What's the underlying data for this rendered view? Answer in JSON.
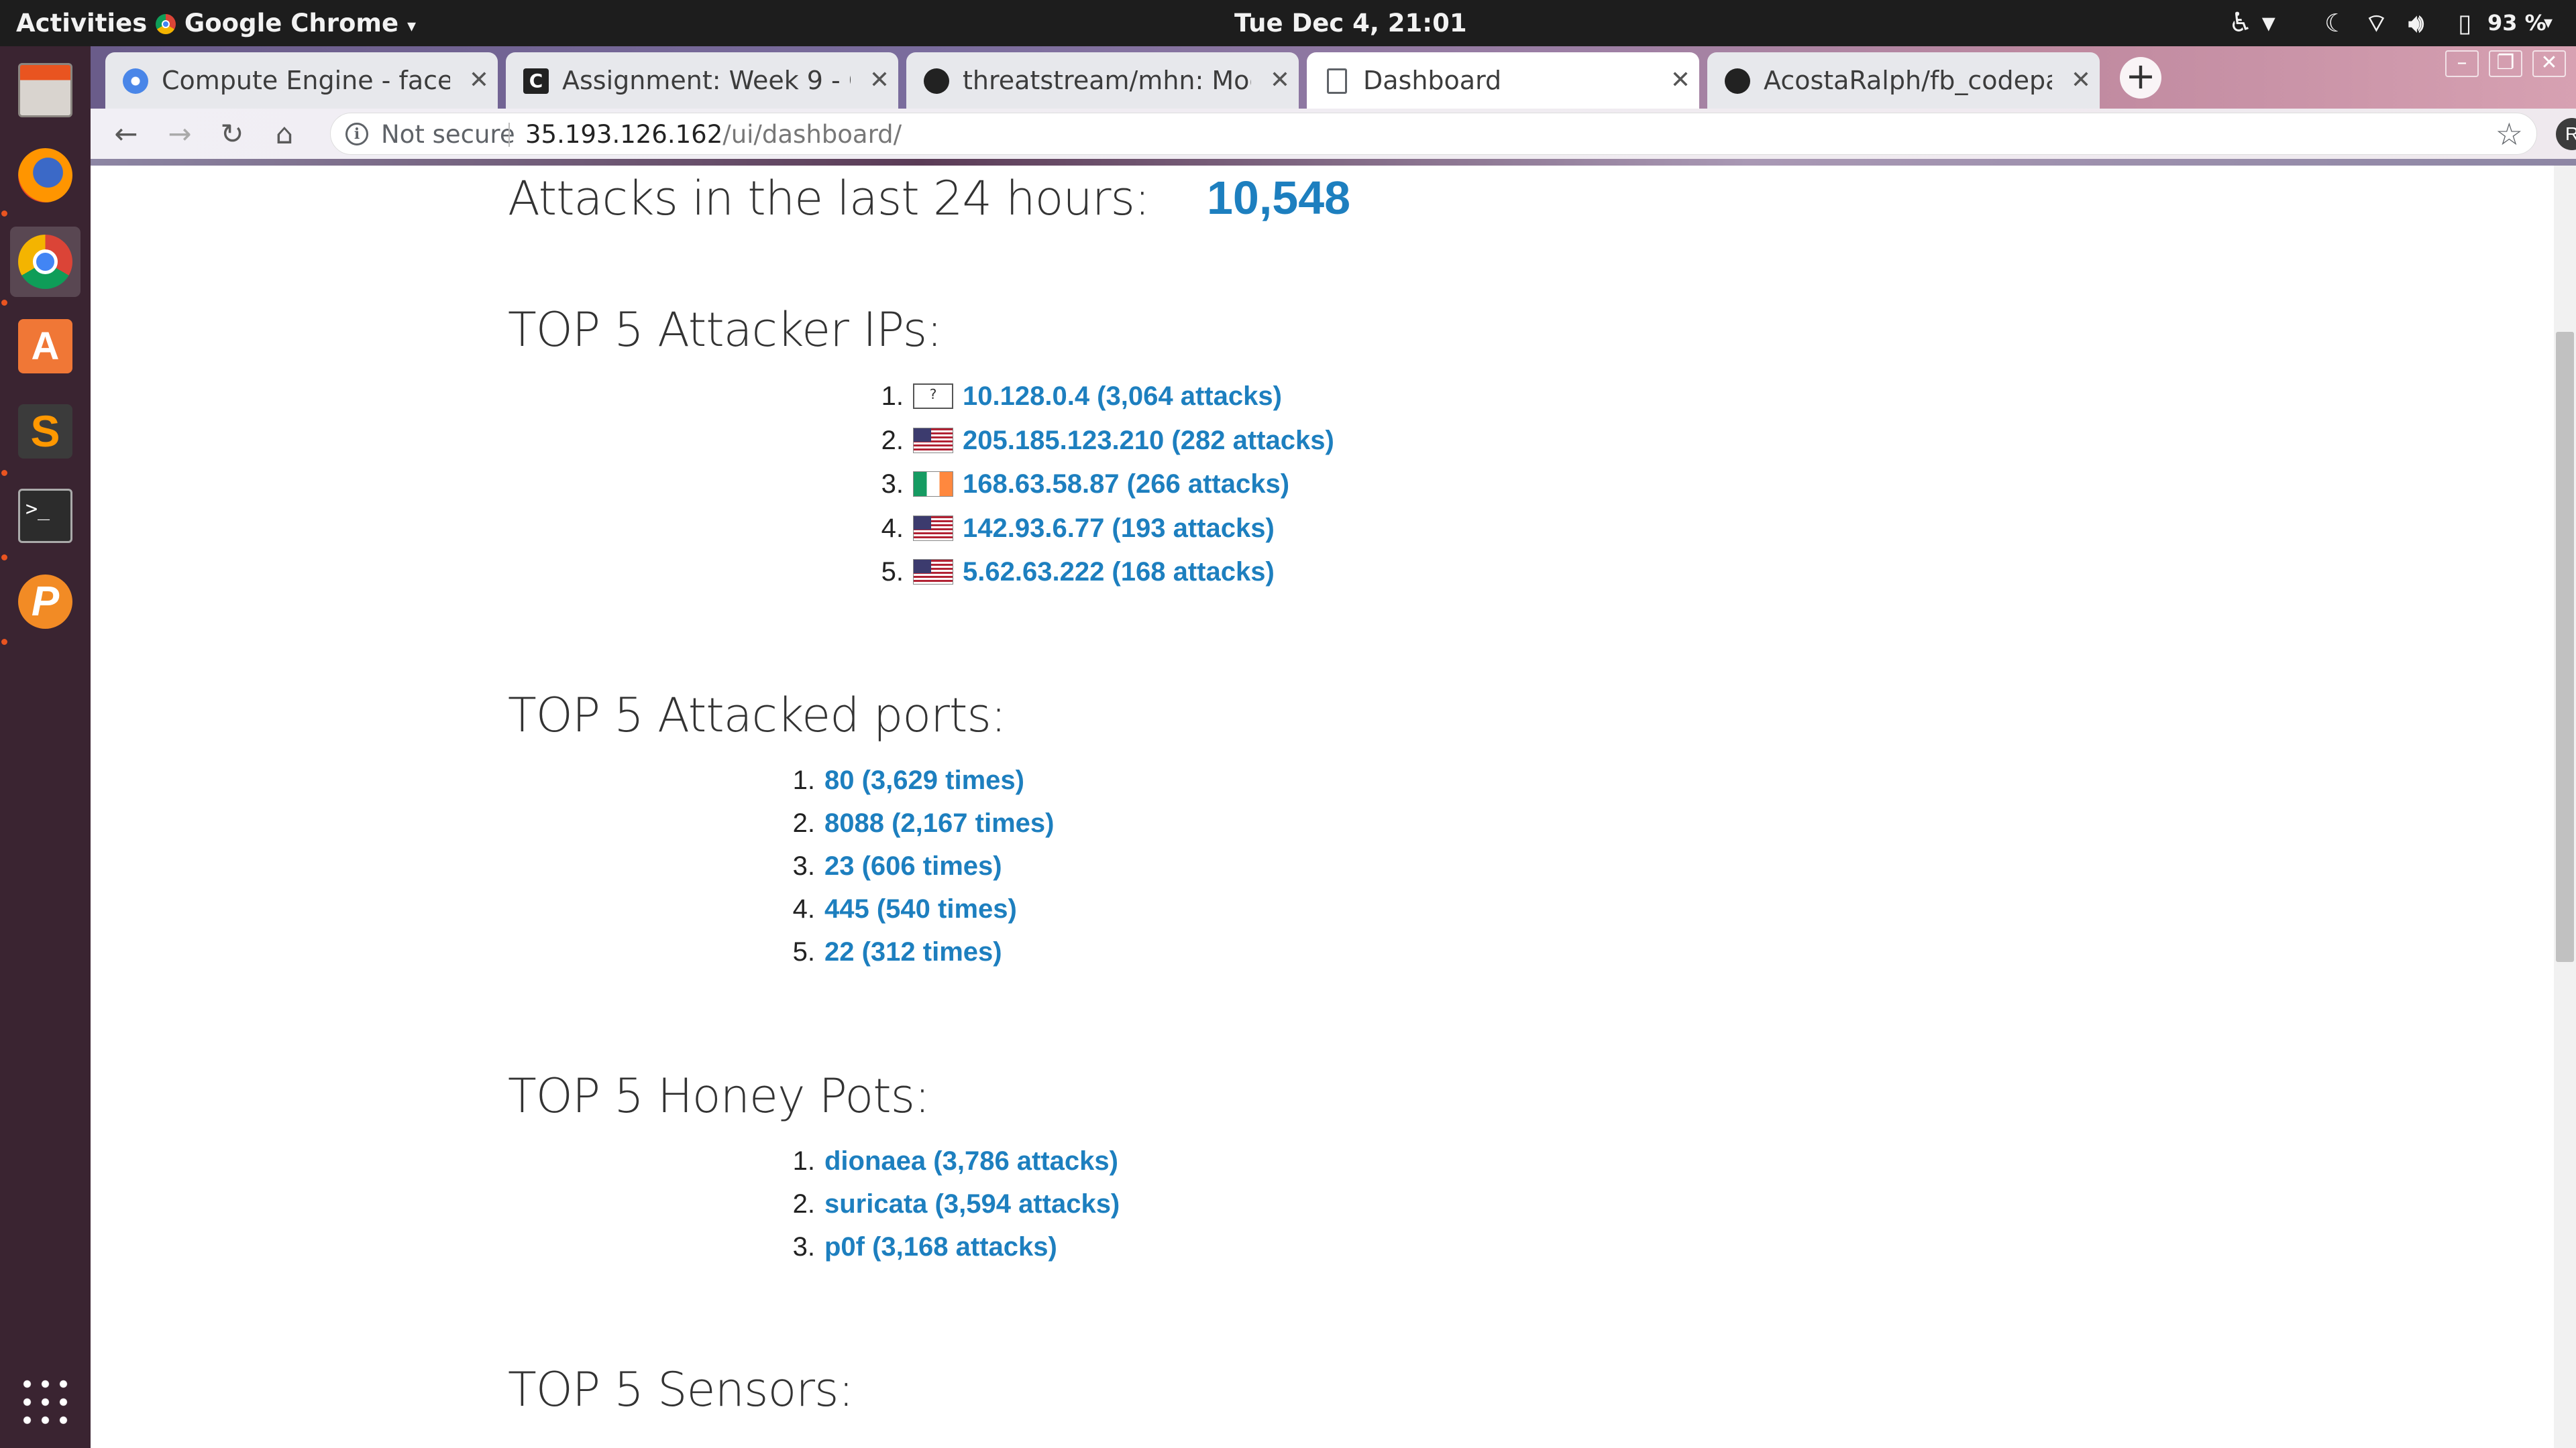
{
  "system_bar": {
    "activities": "Activities",
    "app_name": "Google Chrome",
    "clock": "Tue Dec  4, 21:01",
    "battery": "93 %"
  },
  "dock": {
    "items": [
      "files",
      "firefox",
      "chrome",
      "software-center",
      "sublime-text",
      "terminal",
      "pivotal-tracker",
      "show-apps"
    ]
  },
  "tabs": [
    {
      "title": "Compute Engine - facebo",
      "icon": "gear-icon",
      "active": false
    },
    {
      "title": "Assignment: Week 9 - Cyb",
      "icon": "codepath-icon",
      "active": false
    },
    {
      "title": "threatstream/mhn: Mode",
      "icon": "github-icon",
      "active": false
    },
    {
      "title": "Dashboard",
      "icon": "page-icon",
      "active": true
    },
    {
      "title": "AcostaRalph/fb_codepath",
      "icon": "github-icon",
      "active": false
    }
  ],
  "omnibox": {
    "security": "Not secure",
    "host": "35.193.126.162",
    "path": "/ui/dashboard/"
  },
  "profile_initial": "R",
  "dashboard": {
    "attacks_label": "Attacks in the last 24 hours:",
    "attacks_count": "10,548",
    "top_ips_title": "TOP 5 Attacker IPs:",
    "top_ips": [
      {
        "num": "1.",
        "flag": "unknown",
        "text": "10.128.0.4 (3,064 attacks)"
      },
      {
        "num": "2.",
        "flag": "us",
        "text": "205.185.123.210 (282 attacks)"
      },
      {
        "num": "3.",
        "flag": "ie",
        "text": "168.63.58.87 (266 attacks)"
      },
      {
        "num": "4.",
        "flag": "us",
        "text": "142.93.6.77 (193 attacks)"
      },
      {
        "num": "5.",
        "flag": "us",
        "text": "5.62.63.222 (168 attacks)"
      }
    ],
    "top_ports_title": "TOP 5 Attacked ports:",
    "top_ports": [
      {
        "num": "1.",
        "text": "80 (3,629 times)"
      },
      {
        "num": "2.",
        "text": "8088 (2,167 times)"
      },
      {
        "num": "3.",
        "text": "23 (606 times)"
      },
      {
        "num": "4.",
        "text": "445 (540 times)"
      },
      {
        "num": "5.",
        "text": "22 (312 times)"
      }
    ],
    "honeypots_title": "TOP 5 Honey Pots:",
    "honeypots": [
      {
        "num": "1.",
        "text": "dionaea (3,786 attacks)"
      },
      {
        "num": "2.",
        "text": "suricata (3,594 attacks)"
      },
      {
        "num": "3.",
        "text": "p0f (3,168 attacks)"
      }
    ],
    "sensors_title": "TOP 5 Sensors:"
  }
}
